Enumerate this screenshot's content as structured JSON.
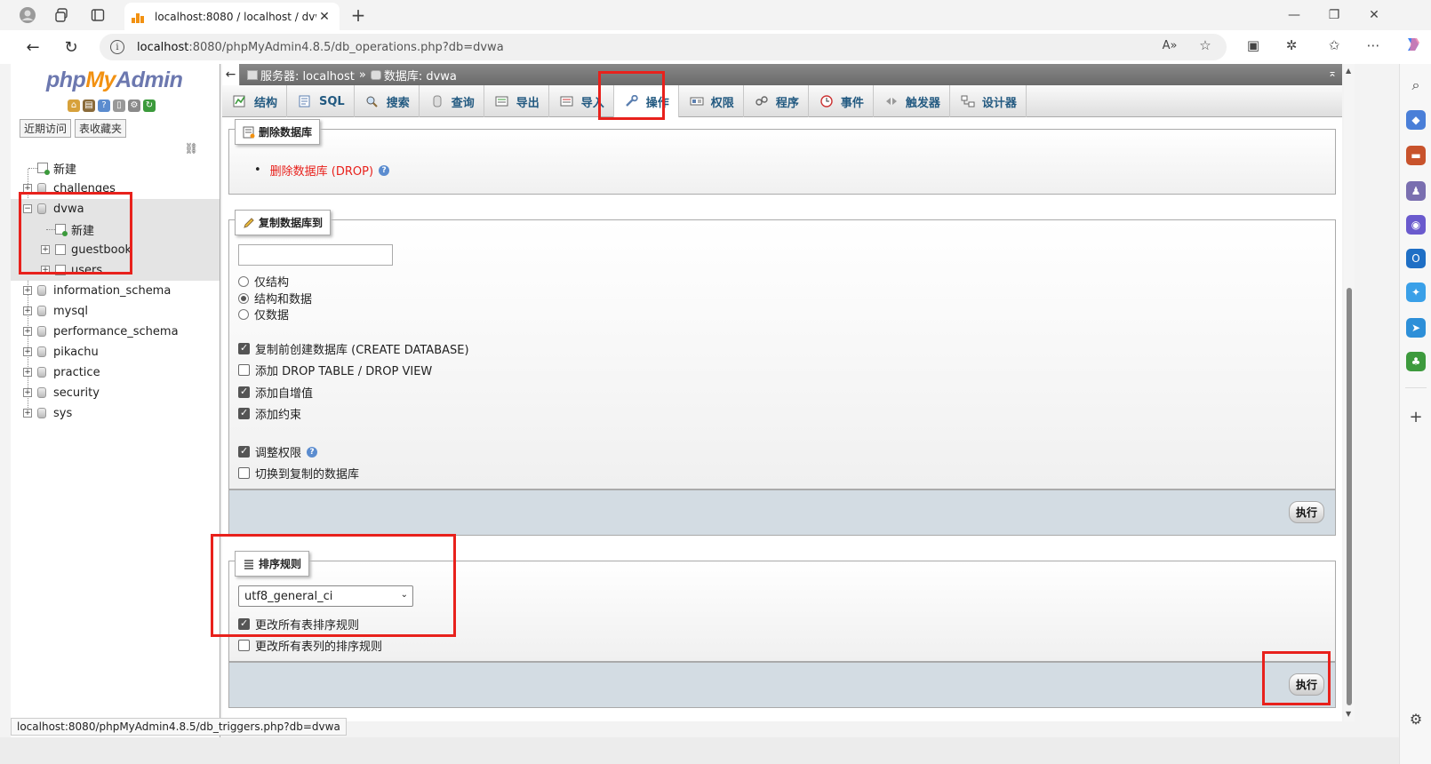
{
  "browser": {
    "tab_title": "localhost:8080 / localhost / dvwa",
    "url_host": "localhost",
    "url_rest": ":8080/phpMyAdmin4.8.5/db_operations.php?db=dvwa",
    "status_url": "localhost:8080/phpMyAdmin4.8.5/db_triggers.php?db=dvwa"
  },
  "left": {
    "logo_php": "php",
    "logo_my": "My",
    "logo_admin": "Admin",
    "recent": "近期访问",
    "favorites": "表收藏夹",
    "tree": {
      "new": "新建",
      "challenges": "challenges",
      "dvwa": "dvwa",
      "dvwa_new": "新建",
      "guestbook": "guestbook",
      "users": "users",
      "information_schema": "information_schema",
      "mysql": "mysql",
      "performance_schema": "performance_schema",
      "pikachu": "pikachu",
      "practice": "practice",
      "security": "security",
      "sys": "sys"
    }
  },
  "main": {
    "crumb_server": "服务器: localhost",
    "crumb_db": "数据库: dvwa",
    "tabs": {
      "structure": "结构",
      "sql": "SQL",
      "search": "搜索",
      "query": "查询",
      "export": "导出",
      "import": "导入",
      "operations": "操作",
      "privileges": "权限",
      "routines": "程序",
      "events": "事件",
      "triggers": "触发器",
      "designer": "设计器"
    },
    "drop": {
      "legend": "删除数据库",
      "link": "删除数据库 (DROP)"
    },
    "copy": {
      "legend": "复制数据库到",
      "input_value": "",
      "opt_structure": "仅结构",
      "opt_structure_data": "结构和数据",
      "opt_data": "仅数据",
      "create_db": "复制前创建数据库 (CREATE DATABASE)",
      "add_drop": "添加 DROP TABLE / DROP VIEW",
      "add_autoinc": "添加自增值",
      "add_constraints": "添加约束",
      "adjust_privs": "调整权限",
      "switch_db": "切换到复制的数据库",
      "execute": "执行"
    },
    "collation": {
      "legend": "排序规则",
      "selected": "utf8_general_ci",
      "change_tables": "更改所有表排序规则",
      "change_columns": "更改所有表列的排序规则",
      "execute": "执行"
    }
  },
  "colors": {
    "accent_red": "#e8211c",
    "pma_link": "#235a81",
    "drop_red": "#e8211c"
  }
}
